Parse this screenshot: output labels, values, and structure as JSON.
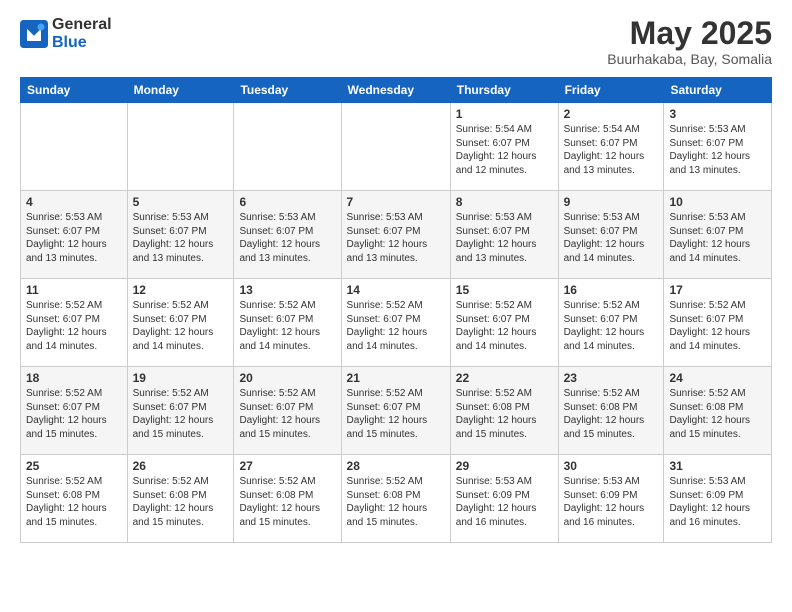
{
  "header": {
    "logo": {
      "general": "General",
      "blue": "Blue"
    },
    "title": "May 2025",
    "location": "Buurhakaba, Bay, Somalia"
  },
  "calendar": {
    "weekdays": [
      "Sunday",
      "Monday",
      "Tuesday",
      "Wednesday",
      "Thursday",
      "Friday",
      "Saturday"
    ],
    "weeks": [
      [
        {
          "day": "",
          "info": ""
        },
        {
          "day": "",
          "info": ""
        },
        {
          "day": "",
          "info": ""
        },
        {
          "day": "",
          "info": ""
        },
        {
          "day": "1",
          "info": "Sunrise: 5:54 AM\nSunset: 6:07 PM\nDaylight: 12 hours\nand 12 minutes."
        },
        {
          "day": "2",
          "info": "Sunrise: 5:54 AM\nSunset: 6:07 PM\nDaylight: 12 hours\nand 13 minutes."
        },
        {
          "day": "3",
          "info": "Sunrise: 5:53 AM\nSunset: 6:07 PM\nDaylight: 12 hours\nand 13 minutes."
        }
      ],
      [
        {
          "day": "4",
          "info": "Sunrise: 5:53 AM\nSunset: 6:07 PM\nDaylight: 12 hours\nand 13 minutes."
        },
        {
          "day": "5",
          "info": "Sunrise: 5:53 AM\nSunset: 6:07 PM\nDaylight: 12 hours\nand 13 minutes."
        },
        {
          "day": "6",
          "info": "Sunrise: 5:53 AM\nSunset: 6:07 PM\nDaylight: 12 hours\nand 13 minutes."
        },
        {
          "day": "7",
          "info": "Sunrise: 5:53 AM\nSunset: 6:07 PM\nDaylight: 12 hours\nand 13 minutes."
        },
        {
          "day": "8",
          "info": "Sunrise: 5:53 AM\nSunset: 6:07 PM\nDaylight: 12 hours\nand 13 minutes."
        },
        {
          "day": "9",
          "info": "Sunrise: 5:53 AM\nSunset: 6:07 PM\nDaylight: 12 hours\nand 14 minutes."
        },
        {
          "day": "10",
          "info": "Sunrise: 5:53 AM\nSunset: 6:07 PM\nDaylight: 12 hours\nand 14 minutes."
        }
      ],
      [
        {
          "day": "11",
          "info": "Sunrise: 5:52 AM\nSunset: 6:07 PM\nDaylight: 12 hours\nand 14 minutes."
        },
        {
          "day": "12",
          "info": "Sunrise: 5:52 AM\nSunset: 6:07 PM\nDaylight: 12 hours\nand 14 minutes."
        },
        {
          "day": "13",
          "info": "Sunrise: 5:52 AM\nSunset: 6:07 PM\nDaylight: 12 hours\nand 14 minutes."
        },
        {
          "day": "14",
          "info": "Sunrise: 5:52 AM\nSunset: 6:07 PM\nDaylight: 12 hours\nand 14 minutes."
        },
        {
          "day": "15",
          "info": "Sunrise: 5:52 AM\nSunset: 6:07 PM\nDaylight: 12 hours\nand 14 minutes."
        },
        {
          "day": "16",
          "info": "Sunrise: 5:52 AM\nSunset: 6:07 PM\nDaylight: 12 hours\nand 14 minutes."
        },
        {
          "day": "17",
          "info": "Sunrise: 5:52 AM\nSunset: 6:07 PM\nDaylight: 12 hours\nand 14 minutes."
        }
      ],
      [
        {
          "day": "18",
          "info": "Sunrise: 5:52 AM\nSunset: 6:07 PM\nDaylight: 12 hours\nand 15 minutes."
        },
        {
          "day": "19",
          "info": "Sunrise: 5:52 AM\nSunset: 6:07 PM\nDaylight: 12 hours\nand 15 minutes."
        },
        {
          "day": "20",
          "info": "Sunrise: 5:52 AM\nSunset: 6:07 PM\nDaylight: 12 hours\nand 15 minutes."
        },
        {
          "day": "21",
          "info": "Sunrise: 5:52 AM\nSunset: 6:07 PM\nDaylight: 12 hours\nand 15 minutes."
        },
        {
          "day": "22",
          "info": "Sunrise: 5:52 AM\nSunset: 6:08 PM\nDaylight: 12 hours\nand 15 minutes."
        },
        {
          "day": "23",
          "info": "Sunrise: 5:52 AM\nSunset: 6:08 PM\nDaylight: 12 hours\nand 15 minutes."
        },
        {
          "day": "24",
          "info": "Sunrise: 5:52 AM\nSunset: 6:08 PM\nDaylight: 12 hours\nand 15 minutes."
        }
      ],
      [
        {
          "day": "25",
          "info": "Sunrise: 5:52 AM\nSunset: 6:08 PM\nDaylight: 12 hours\nand 15 minutes."
        },
        {
          "day": "26",
          "info": "Sunrise: 5:52 AM\nSunset: 6:08 PM\nDaylight: 12 hours\nand 15 minutes."
        },
        {
          "day": "27",
          "info": "Sunrise: 5:52 AM\nSunset: 6:08 PM\nDaylight: 12 hours\nand 15 minutes."
        },
        {
          "day": "28",
          "info": "Sunrise: 5:52 AM\nSunset: 6:08 PM\nDaylight: 12 hours\nand 15 minutes."
        },
        {
          "day": "29",
          "info": "Sunrise: 5:53 AM\nSunset: 6:09 PM\nDaylight: 12 hours\nand 16 minutes."
        },
        {
          "day": "30",
          "info": "Sunrise: 5:53 AM\nSunset: 6:09 PM\nDaylight: 12 hours\nand 16 minutes."
        },
        {
          "day": "31",
          "info": "Sunrise: 5:53 AM\nSunset: 6:09 PM\nDaylight: 12 hours\nand 16 minutes."
        }
      ]
    ]
  }
}
